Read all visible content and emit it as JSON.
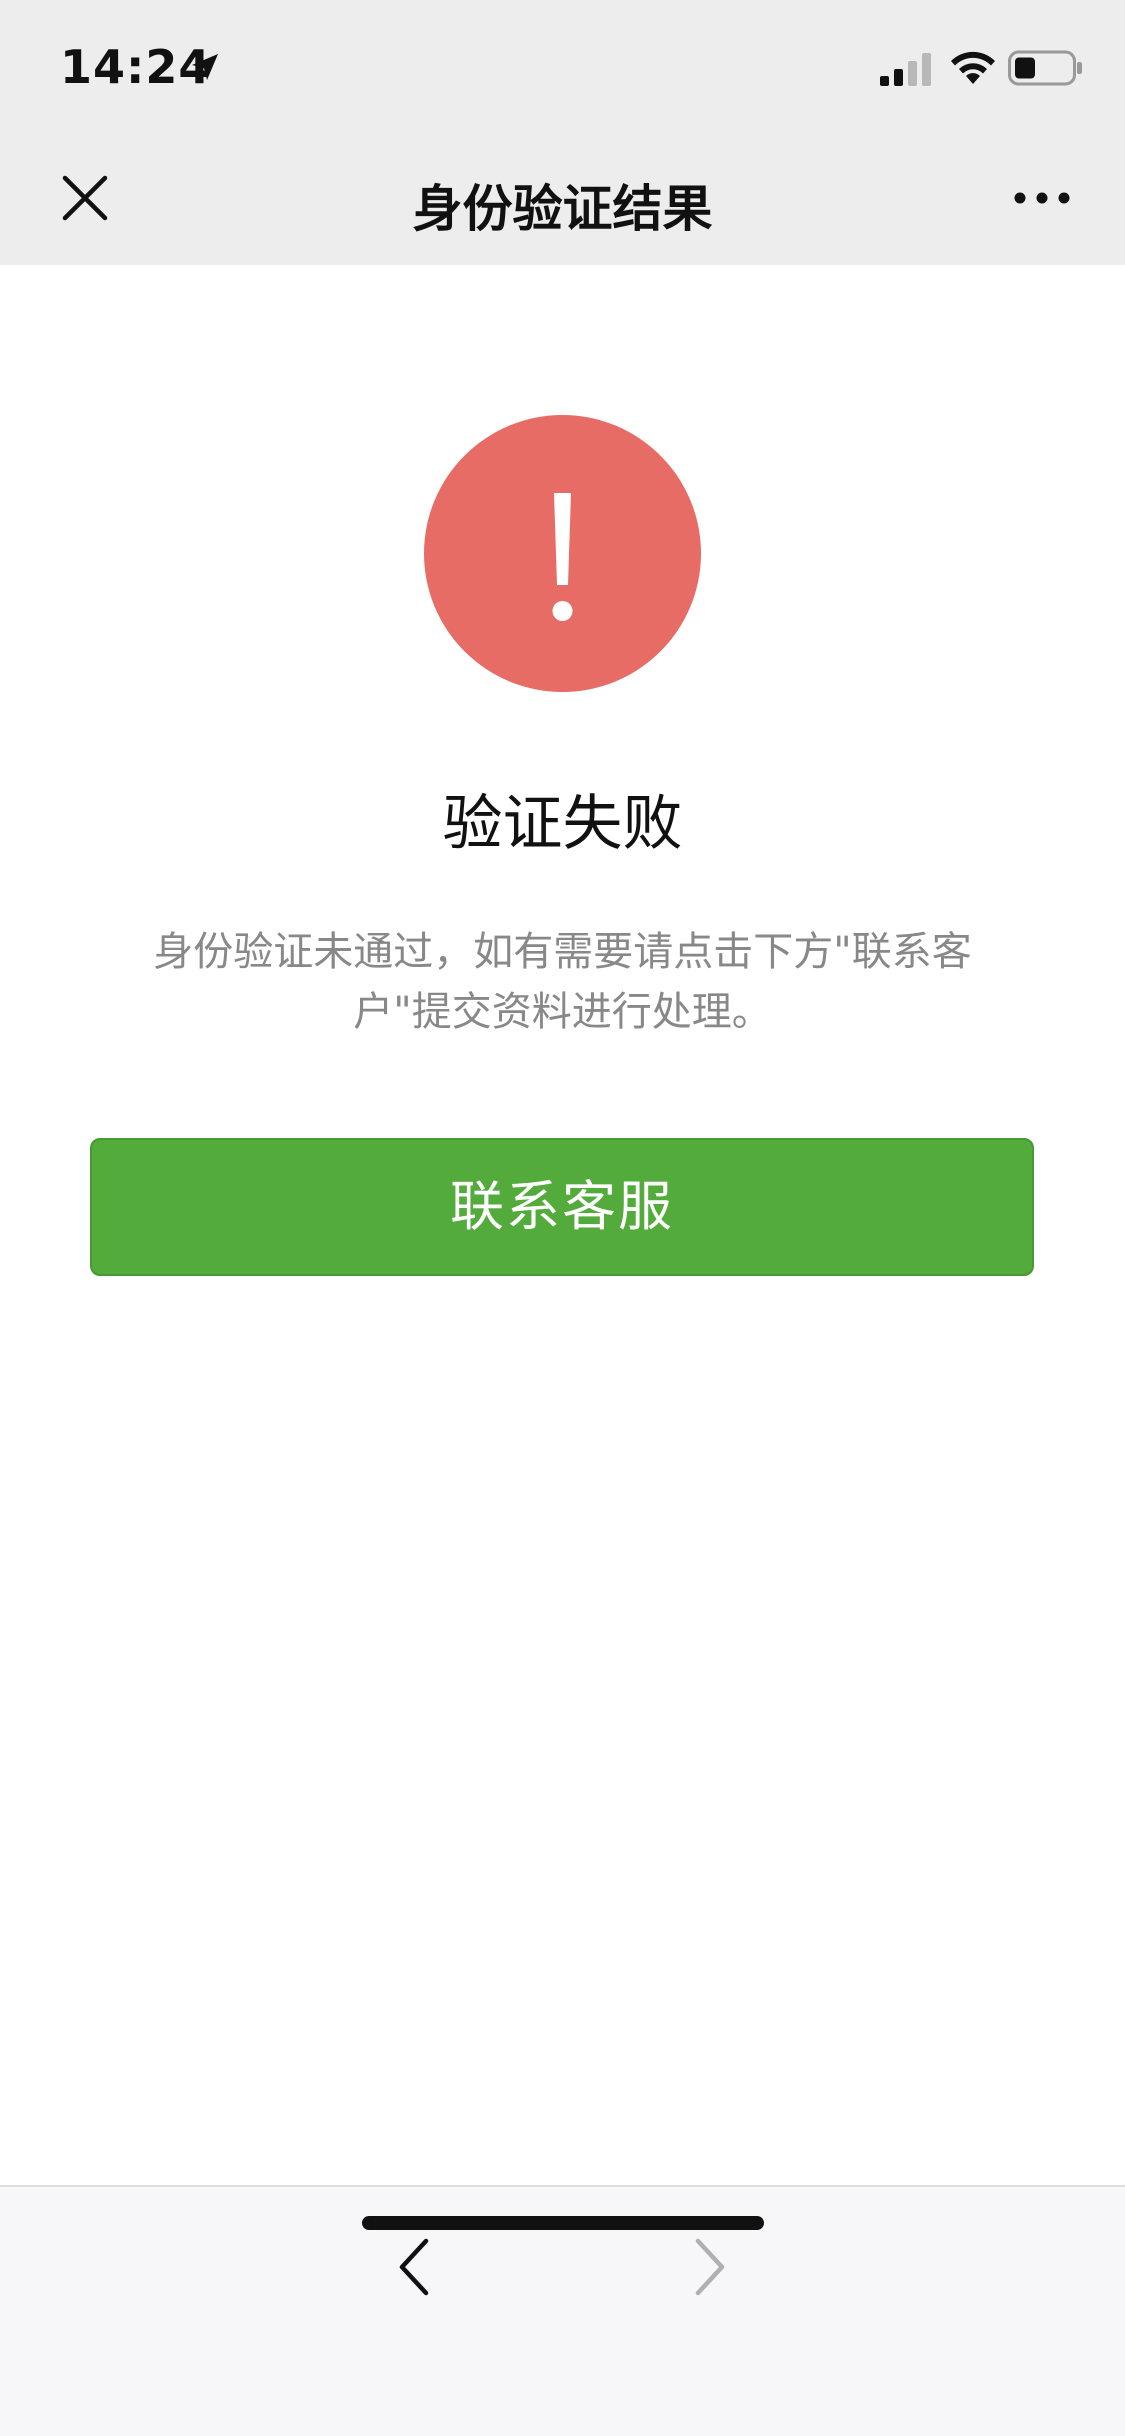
{
  "status_bar": {
    "time": "14:24",
    "icons": [
      "location-arrow-icon",
      "signal-icon",
      "wifi-icon",
      "battery-icon"
    ]
  },
  "nav": {
    "title": "身份验证结果",
    "left_icon": "close-icon",
    "right_icon": "more-icon"
  },
  "result": {
    "icon": "exclamation-icon",
    "title": "验证失败",
    "description": "身份验证未通过，如有需要请点击下方\"联系客户\"提交资料进行处理。"
  },
  "actions": {
    "contact_label": "联系客服"
  },
  "toolbar": {
    "back_icon": "chevron-left-icon",
    "forward_icon": "chevron-right-icon"
  },
  "colors": {
    "header_bg": "#ededed",
    "alert": "#e76c65",
    "primary": "#52ab3a",
    "muted_text": "#888888",
    "disabled_icon": "#b0b0b0"
  }
}
